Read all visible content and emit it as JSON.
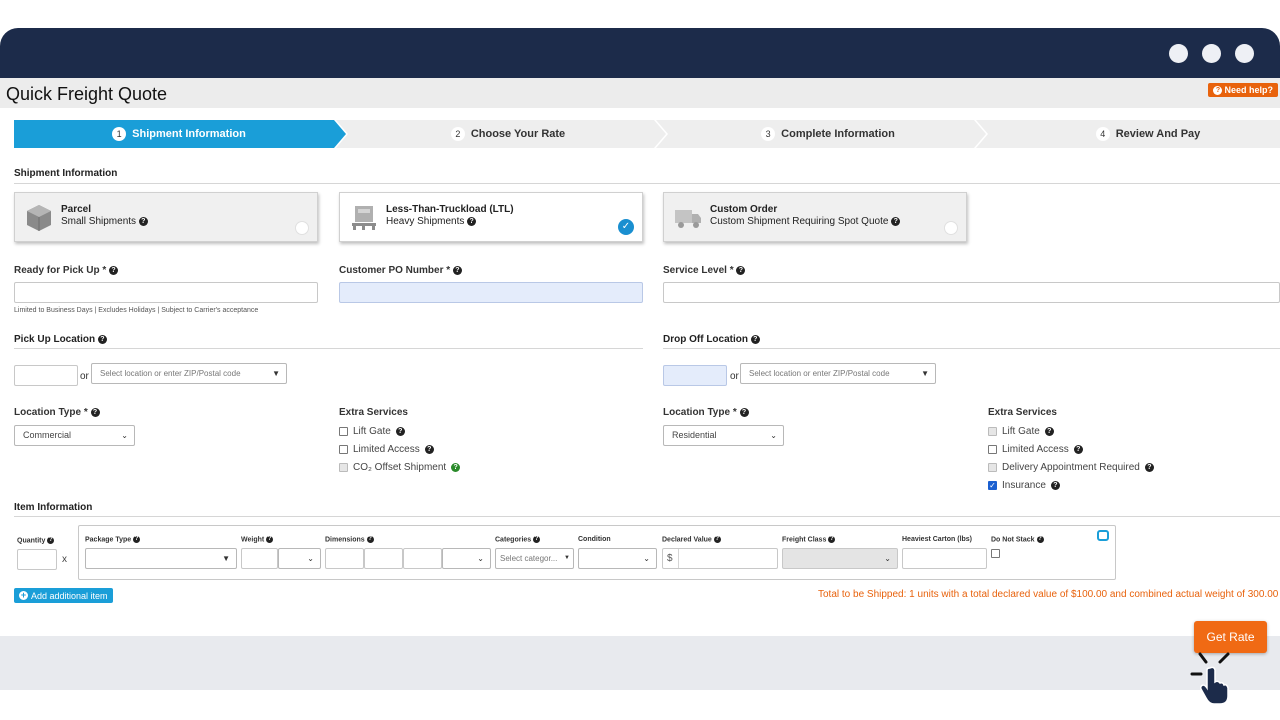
{
  "window": {
    "controls": [
      "dot-1",
      "dot-2",
      "dot-3"
    ]
  },
  "header": {
    "title": "Quick Freight Quote",
    "help_label": "Need help?"
  },
  "steps": [
    {
      "num": "1",
      "label": "Shipment Information",
      "active": true
    },
    {
      "num": "2",
      "label": "Choose Your Rate",
      "active": false
    },
    {
      "num": "3",
      "label": "Complete Information",
      "active": false
    },
    {
      "num": "4",
      "label": "Review And Pay",
      "active": false
    }
  ],
  "shipment": {
    "section_title": "Shipment Information",
    "cards": [
      {
        "title": "Parcel",
        "subtitle": "Small Shipments",
        "icon": "box-icon",
        "selected": false
      },
      {
        "title": "Less-Than-Truckload (LTL)",
        "subtitle": "Heavy Shipments",
        "icon": "pallet-icon",
        "selected": true
      },
      {
        "title": "Custom Order",
        "subtitle": "Custom Shipment Requiring Spot Quote",
        "icon": "truck-icon",
        "selected": false
      }
    ]
  },
  "fields": {
    "pickup_ready_label": "Ready for Pick Up *",
    "pickup_ready_hint": "Limited to Business Days | Excludes Holidays | Subject to Carrier's acceptance",
    "po_number_label": "Customer PO Number *",
    "service_level_label": "Service Level *"
  },
  "pickup": {
    "title": "Pick Up Location",
    "or": "or",
    "location_placeholder": "Select location or enter ZIP/Postal code",
    "location_type_label": "Location Type *",
    "location_type_value": "Commercial",
    "extras_title": "Extra Services",
    "extras": [
      {
        "label": "Lift Gate",
        "state": "off",
        "help": "dark"
      },
      {
        "label": "Limited Access",
        "state": "off",
        "help": "dark"
      },
      {
        "label": "CO₂ Offset Shipment",
        "state": "disabled",
        "help": "green"
      }
    ]
  },
  "dropoff": {
    "title": "Drop Off Location",
    "or": "or",
    "location_placeholder": "Select location or enter ZIP/Postal code",
    "location_type_label": "Location Type *",
    "location_type_value": "Residential",
    "extras_title": "Extra Services",
    "extras": [
      {
        "label": "Lift Gate",
        "state": "disabled",
        "help": "dark"
      },
      {
        "label": "Limited Access",
        "state": "off",
        "help": "dark"
      },
      {
        "label": "Delivery Appointment Required",
        "state": "disabled",
        "help": "dark"
      },
      {
        "label": "Insurance",
        "state": "on",
        "help": "dark"
      }
    ]
  },
  "items": {
    "section_title": "Item Information",
    "quantity_label": "Quantity",
    "x_sep": "x",
    "headers": {
      "package_type": "Package Type",
      "weight": "Weight",
      "dimensions": "Dimensions",
      "categories": "Categories",
      "condition": "Condition",
      "declared_value": "Declared Value",
      "freight_class": "Freight Class",
      "heaviest_carton": "Heaviest Carton (lbs)",
      "do_not_stack": "Do Not Stack"
    },
    "categories_placeholder": "Select categor...",
    "currency": "$",
    "add_button": "Add additional item"
  },
  "summary": {
    "total_text": "Total to be Shipped: 1 units with a total declared value of $100.00 and combined actual weight of 300.00 lbs"
  },
  "footer": {
    "get_rate": "Get Rate"
  },
  "colors": {
    "accent": "#1a9ed8",
    "cta": "#f06a14",
    "frame": "#1c2b4a"
  }
}
